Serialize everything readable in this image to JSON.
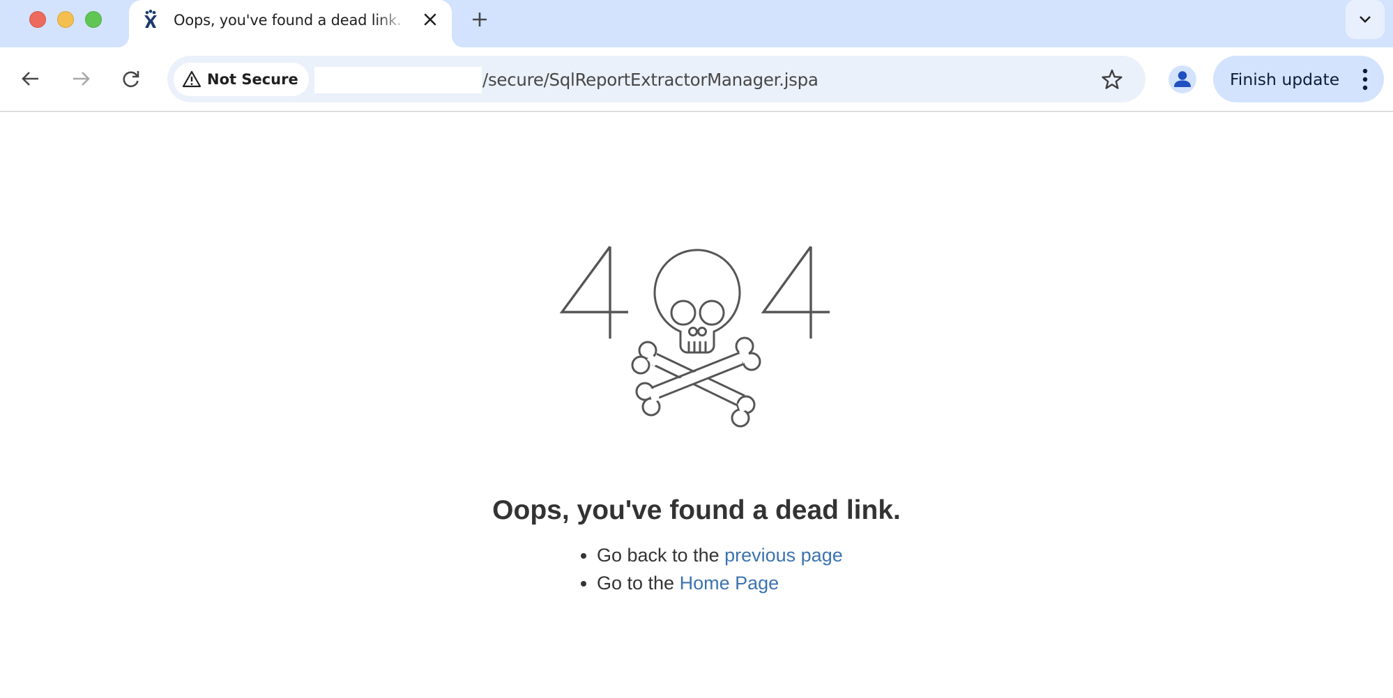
{
  "browser": {
    "window_controls": {
      "close": "close",
      "minimize": "minimize",
      "zoom": "zoom"
    },
    "tab": {
      "title": "Oops, you've found a dead link.",
      "favicon": "atlassian-jira-icon",
      "close_icon": "close-icon"
    },
    "new_tab_icon": "plus-icon",
    "tab_search_icon": "chevron-down-icon",
    "toolbar": {
      "back_icon": "arrow-left-icon",
      "forward_icon": "arrow-right-icon",
      "reload_icon": "reload-icon",
      "security_chip": {
        "icon": "warning-triangle-icon",
        "label": "Not Secure"
      },
      "url_path": "/secure/SqlReportExtractorManager.jspa",
      "bookmark_icon": "star-icon",
      "profile_icon": "person-icon",
      "update_button": {
        "label": "Finish update",
        "menu_icon": "vertical-dots-icon"
      }
    },
    "colors": {
      "tabstrip_bg": "#d3e3fd",
      "omnibox_bg": "#ebf1fa",
      "update_btn_bg": "#d3e3fd",
      "profile_accent": "#1f4fc0"
    }
  },
  "page": {
    "error_code_left": "4",
    "error_code_right": "4",
    "graphic_icon": "skull-crossbones-icon",
    "heading": "Oops, you've found a dead link.",
    "items": [
      {
        "prefix": "Go back to the ",
        "link_text": "previous page"
      },
      {
        "prefix": "Go to the ",
        "link_text": "Home Page"
      }
    ],
    "colors": {
      "text": "#333333",
      "link": "#3b73af",
      "graphic_stroke": "#555555"
    }
  }
}
